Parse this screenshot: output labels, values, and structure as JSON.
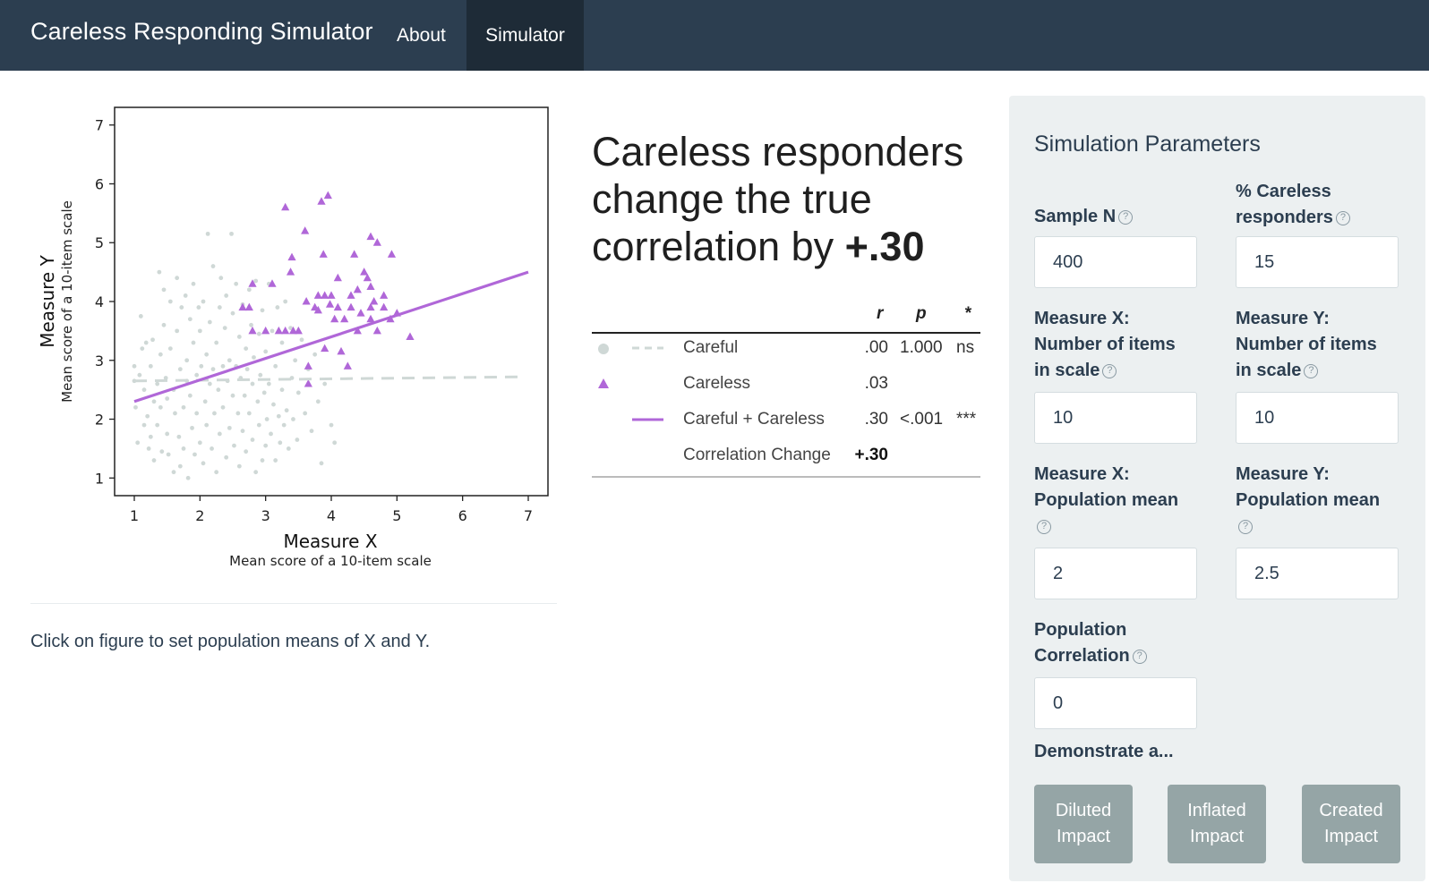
{
  "navbar": {
    "brand": "Careless Responding Simulator",
    "items": [
      {
        "label": "About",
        "active": false
      },
      {
        "label": "Simulator",
        "active": true
      }
    ],
    "color": "#2c3e50"
  },
  "main": {
    "hint": "Click on figure to set population means of X and Y.",
    "headline_prefix": "Careless responders change the true correlation by ",
    "headline_value": "+.30"
  },
  "stats_table": {
    "headers": {
      "r": "r",
      "p": "p",
      "sig": "*"
    },
    "rows": [
      {
        "label": "Careful",
        "r": ".00",
        "p": "1.000",
        "sig": "ns",
        "legend": "circle-dash"
      },
      {
        "label": "Careless",
        "r": ".03",
        "p": "",
        "sig": "",
        "legend": "triangle"
      },
      {
        "label": "Careful + Careless",
        "r": ".30",
        "p": "<.001",
        "sig": "***",
        "legend": "solid-line"
      },
      {
        "label": "Correlation Change",
        "r": "+.30",
        "p": "",
        "sig": "",
        "legend": "none"
      }
    ]
  },
  "chart_data": {
    "type": "scatter",
    "title": "",
    "xlabel": "Measure X",
    "xlabel_sub": "Mean score of a 10-item scale",
    "ylabel": "Measure Y",
    "ylabel_sub": "Mean score of a 10-item scale",
    "xlim": [
      0.7,
      7.3
    ],
    "ylim": [
      0.7,
      7.3
    ],
    "xticks": [
      "1",
      "2",
      "3",
      "4",
      "5",
      "6",
      "7"
    ],
    "yticks": [
      "1",
      "2",
      "3",
      "4",
      "5",
      "6",
      "7"
    ],
    "grid": false,
    "colors": {
      "careful": "#cfd8d6",
      "careless": "#b067d8",
      "careful_line": "#cfd8d6",
      "combined_line": "#b067d8"
    },
    "series": [
      {
        "name": "Careful",
        "marker": "circle",
        "points": [
          [
            1.0,
            2.9
          ],
          [
            1.0,
            2.65
          ],
          [
            1.02,
            2.2
          ],
          [
            1.05,
            1.6
          ],
          [
            1.08,
            2.75
          ],
          [
            1.1,
            3.75
          ],
          [
            1.12,
            3.2
          ],
          [
            1.15,
            2.5
          ],
          [
            1.15,
            1.9
          ],
          [
            1.18,
            3.3
          ],
          [
            1.2,
            2.05
          ],
          [
            1.22,
            1.5
          ],
          [
            1.25,
            2.9
          ],
          [
            1.25,
            1.7
          ],
          [
            1.28,
            3.35
          ],
          [
            1.3,
            2.3
          ],
          [
            1.3,
            1.3
          ],
          [
            1.35,
            2.6
          ],
          [
            1.35,
            1.9
          ],
          [
            1.38,
            4.5
          ],
          [
            1.4,
            3.1
          ],
          [
            1.4,
            2.2
          ],
          [
            1.42,
            1.45
          ],
          [
            1.45,
            4.2
          ],
          [
            1.45,
            3.6
          ],
          [
            1.48,
            2.7
          ],
          [
            1.5,
            1.75
          ],
          [
            1.5,
            2.35
          ],
          [
            1.52,
            1.4
          ],
          [
            1.55,
            3.2
          ],
          [
            1.55,
            4.0
          ],
          [
            1.6,
            2.5
          ],
          [
            1.6,
            1.1
          ],
          [
            1.62,
            2.1
          ],
          [
            1.65,
            3.5
          ],
          [
            1.65,
            4.4
          ],
          [
            1.68,
            1.7
          ],
          [
            1.7,
            2.85
          ],
          [
            1.7,
            1.2
          ],
          [
            1.72,
            3.9
          ],
          [
            1.75,
            2.2
          ],
          [
            1.75,
            1.5
          ],
          [
            1.78,
            4.1
          ],
          [
            1.8,
            3.0
          ],
          [
            1.8,
            2.65
          ],
          [
            1.82,
            1.0
          ],
          [
            1.85,
            3.7
          ],
          [
            1.85,
            2.4
          ],
          [
            1.88,
            1.85
          ],
          [
            1.9,
            4.3
          ],
          [
            1.9,
            3.3
          ],
          [
            1.92,
            1.4
          ],
          [
            1.95,
            2.75
          ],
          [
            1.95,
            2.1
          ],
          [
            1.98,
            3.9
          ],
          [
            2.0,
            1.6
          ],
          [
            2.0,
            3.5
          ],
          [
            2.02,
            2.9
          ],
          [
            2.05,
            1.25
          ],
          [
            2.05,
            4.0
          ],
          [
            2.08,
            2.3
          ],
          [
            2.1,
            3.1
          ],
          [
            2.1,
            1.9
          ],
          [
            2.12,
            5.15
          ],
          [
            2.15,
            2.6
          ],
          [
            2.15,
            3.65
          ],
          [
            2.18,
            1.5
          ],
          [
            2.2,
            4.6
          ],
          [
            2.2,
            2.85
          ],
          [
            2.22,
            2.1
          ],
          [
            2.25,
            3.3
          ],
          [
            2.25,
            1.1
          ],
          [
            2.28,
            2.5
          ],
          [
            2.3,
            3.9
          ],
          [
            2.3,
            1.75
          ],
          [
            2.32,
            4.4
          ],
          [
            2.35,
            2.9
          ],
          [
            2.35,
            2.2
          ],
          [
            2.38,
            3.55
          ],
          [
            2.4,
            1.35
          ],
          [
            2.4,
            4.1
          ],
          [
            2.42,
            2.65
          ],
          [
            2.45,
            3.0
          ],
          [
            2.45,
            1.85
          ],
          [
            2.48,
            5.15
          ],
          [
            2.5,
            2.4
          ],
          [
            2.5,
            3.8
          ],
          [
            2.52,
            1.55
          ],
          [
            2.55,
            2.9
          ],
          [
            2.55,
            4.3
          ],
          [
            2.58,
            2.1
          ],
          [
            2.6,
            3.4
          ],
          [
            2.6,
            1.2
          ],
          [
            2.62,
            2.7
          ],
          [
            2.65,
            3.95
          ],
          [
            2.65,
            1.8
          ],
          [
            2.68,
            2.4
          ],
          [
            2.7,
            3.2
          ],
          [
            2.7,
            1.45
          ],
          [
            2.72,
            2.85
          ],
          [
            2.75,
            4.2
          ],
          [
            2.75,
            2.1
          ],
          [
            2.78,
            3.6
          ],
          [
            2.8,
            1.65
          ],
          [
            2.8,
            2.6
          ],
          [
            2.82,
            3.05
          ],
          [
            2.85,
            1.1
          ],
          [
            2.85,
            4.35
          ],
          [
            2.88,
            2.3
          ],
          [
            2.9,
            3.45
          ],
          [
            2.9,
            1.9
          ],
          [
            2.92,
            2.75
          ],
          [
            2.95,
            1.3
          ],
          [
            2.95,
            3.85
          ],
          [
            2.98,
            2.45
          ],
          [
            3.0,
            1.55
          ],
          [
            3.0,
            3.15
          ],
          [
            3.02,
            2.0
          ],
          [
            3.05,
            4.3
          ],
          [
            3.05,
            2.6
          ],
          [
            3.08,
            1.75
          ],
          [
            3.1,
            3.5
          ],
          [
            3.12,
            2.25
          ],
          [
            3.15,
            1.3
          ],
          [
            3.15,
            2.9
          ],
          [
            3.18,
            3.9
          ],
          [
            3.2,
            2.05
          ],
          [
            3.22,
            1.6
          ],
          [
            3.25,
            3.3
          ],
          [
            3.25,
            2.5
          ],
          [
            3.28,
            1.9
          ],
          [
            3.3,
            4.0
          ],
          [
            3.32,
            2.15
          ],
          [
            3.35,
            1.5
          ],
          [
            3.38,
            3.55
          ],
          [
            3.4,
            2.7
          ],
          [
            3.42,
            2.0
          ],
          [
            3.45,
            3.0
          ],
          [
            3.48,
            1.65
          ],
          [
            3.5,
            2.45
          ],
          [
            3.55,
            3.35
          ],
          [
            3.6,
            2.1
          ],
          [
            3.65,
            2.85
          ],
          [
            3.7,
            1.8
          ],
          [
            3.75,
            3.1
          ],
          [
            3.8,
            2.3
          ],
          [
            3.85,
            1.25
          ],
          [
            3.9,
            2.6
          ],
          [
            4.0,
            1.9
          ],
          [
            4.05,
            1.6
          ]
        ]
      },
      {
        "name": "Careless",
        "marker": "triangle",
        "points": [
          [
            2.65,
            3.9
          ],
          [
            2.75,
            3.9
          ],
          [
            2.8,
            4.3
          ],
          [
            2.8,
            3.5
          ],
          [
            3.0,
            3.5
          ],
          [
            3.1,
            4.3
          ],
          [
            3.2,
            3.5
          ],
          [
            3.3,
            3.5
          ],
          [
            3.3,
            5.6
          ],
          [
            3.38,
            4.5
          ],
          [
            3.4,
            4.75
          ],
          [
            3.42,
            3.5
          ],
          [
            3.5,
            3.5
          ],
          [
            3.6,
            5.2
          ],
          [
            3.62,
            4.0
          ],
          [
            3.65,
            2.9
          ],
          [
            3.65,
            2.6
          ],
          [
            3.75,
            3.9
          ],
          [
            3.8,
            4.1
          ],
          [
            3.8,
            3.85
          ],
          [
            3.85,
            5.7
          ],
          [
            3.88,
            4.8
          ],
          [
            3.9,
            3.2
          ],
          [
            3.9,
            4.1
          ],
          [
            3.95,
            5.8
          ],
          [
            3.98,
            3.95
          ],
          [
            4.0,
            4.1
          ],
          [
            4.05,
            3.7
          ],
          [
            4.1,
            3.9
          ],
          [
            4.1,
            4.4
          ],
          [
            4.15,
            3.15
          ],
          [
            4.2,
            3.7
          ],
          [
            4.25,
            2.9
          ],
          [
            4.3,
            3.9
          ],
          [
            4.3,
            4.1
          ],
          [
            4.35,
            4.8
          ],
          [
            4.4,
            3.5
          ],
          [
            4.4,
            4.2
          ],
          [
            4.45,
            3.8
          ],
          [
            4.5,
            4.5
          ],
          [
            4.55,
            4.4
          ],
          [
            4.6,
            3.9
          ],
          [
            4.6,
            4.25
          ],
          [
            4.6,
            3.7
          ],
          [
            4.6,
            5.1
          ],
          [
            4.65,
            4.0
          ],
          [
            4.7,
            3.5
          ],
          [
            4.7,
            5.0
          ],
          [
            4.8,
            4.1
          ],
          [
            4.8,
            3.9
          ],
          [
            4.9,
            3.7
          ],
          [
            4.92,
            4.8
          ],
          [
            5.0,
            3.8
          ],
          [
            5.2,
            3.4
          ]
        ]
      }
    ],
    "lines": [
      {
        "name": "Careful",
        "style": "dashed",
        "x": [
          1.0,
          6.9
        ],
        "y": [
          2.65,
          2.72
        ]
      },
      {
        "name": "Careful + Careless",
        "style": "solid",
        "x": [
          1.0,
          7.0
        ],
        "y": [
          2.3,
          4.5
        ]
      }
    ]
  },
  "panel": {
    "title": "Simulation Parameters",
    "fields": {
      "sample_n": {
        "label": "Sample N",
        "value": "400"
      },
      "pct_careless": {
        "label": "% Careless responders",
        "value": "15"
      },
      "items_x": {
        "label": "Measure X: Number of items in scale",
        "value": "10"
      },
      "items_y": {
        "label": "Measure Y: Number of items in scale",
        "value": "10"
      },
      "mean_x": {
        "label": "Measure X: Population mean",
        "value": "2"
      },
      "mean_y": {
        "label": "Measure Y: Population mean",
        "value": "2.5"
      },
      "correlation": {
        "label": "Population Correlation",
        "value": "0"
      }
    },
    "demo_label": "Demonstrate a...",
    "demo_buttons": [
      "Diluted\nImpact",
      "Inflated\nImpact",
      "Created\nImpact"
    ],
    "help_glyph": "?"
  }
}
